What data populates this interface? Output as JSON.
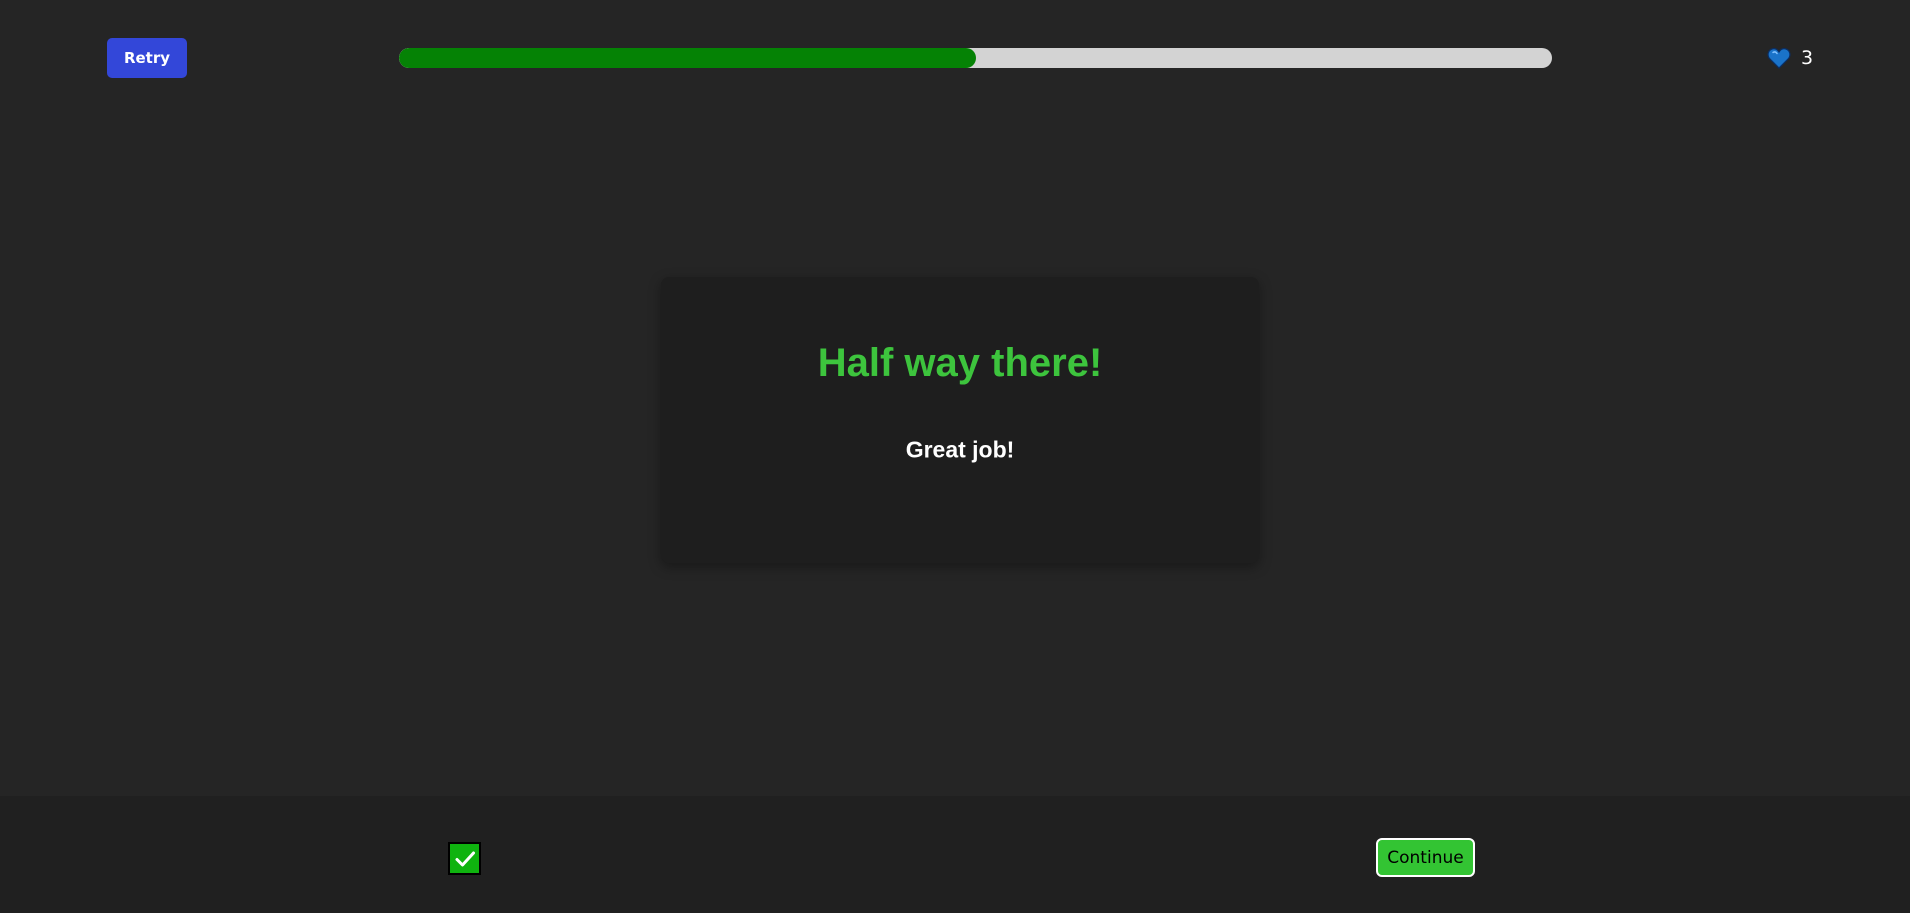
{
  "header": {
    "retry_label": "Retry",
    "progress": {
      "value_percent": 50,
      "fill_color": "#058205",
      "track_color": "#d3d3d3"
    },
    "lives": {
      "icon": "heart-icon",
      "icon_color": "#1a73c9",
      "count": "3"
    }
  },
  "card": {
    "title": "Half way there!",
    "subtitle": "Great job!",
    "title_color": "#3dc43d"
  },
  "footer": {
    "status_icon": "check-icon",
    "status_color": "#0fb30f",
    "continue_label": "Continue",
    "continue_color": "#33c433"
  },
  "colors": {
    "background": "#252525",
    "accent_blue": "#3347d9"
  }
}
